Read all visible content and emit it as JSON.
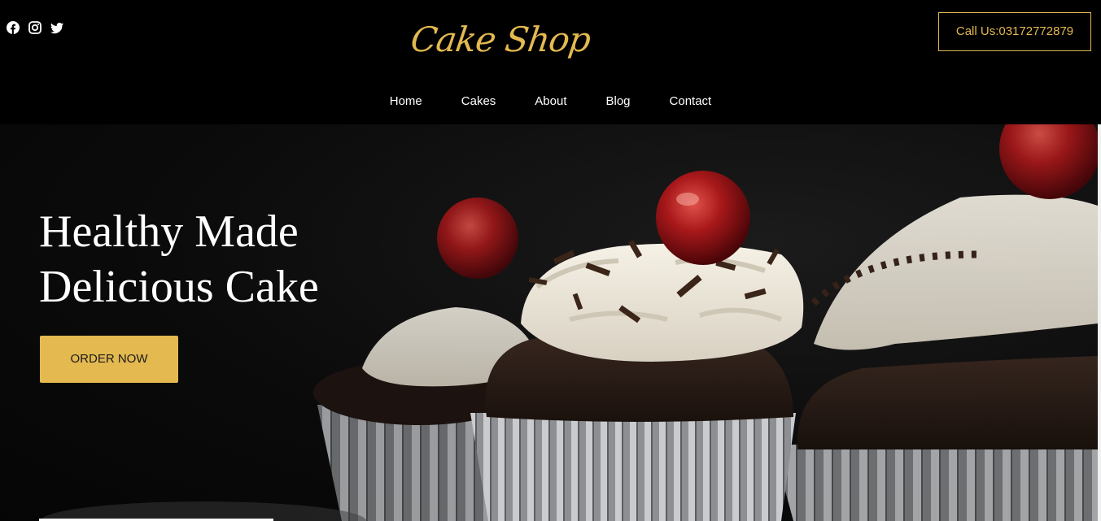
{
  "header": {
    "social": [
      {
        "icon": "facebook-icon"
      },
      {
        "icon": "instagram-icon"
      },
      {
        "icon": "twitter-icon"
      }
    ],
    "logo_text": "Cake Shop",
    "call_label": "Call Us:03172772879",
    "nav": [
      "Home",
      "Cakes",
      "About",
      "Blog",
      "Contact"
    ]
  },
  "hero": {
    "title_line1": "Healthy Made",
    "title_line2": "Delicious Cake",
    "cta_label": "ORDER NOW"
  },
  "colors": {
    "accent": "#e3b950",
    "background": "#000000",
    "text": "#ffffff"
  }
}
